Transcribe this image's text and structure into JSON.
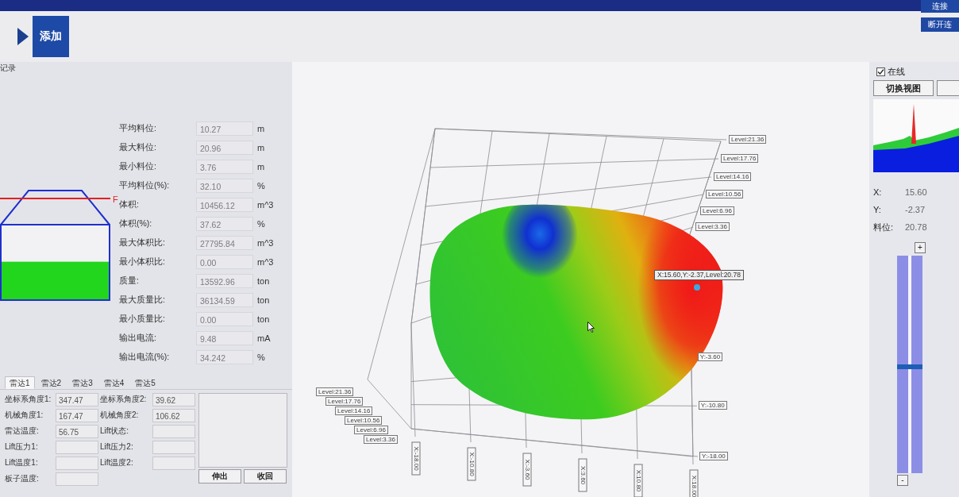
{
  "header": {
    "connect_button": "连接",
    "disconnect_button": "断开连",
    "add_tile": "添加"
  },
  "sidebar": {
    "record_label": "记录"
  },
  "silo": {
    "level": 0.32,
    "marker_label": "F"
  },
  "measurements": [
    {
      "label": "平均料位:",
      "value": "10.27",
      "unit": "m"
    },
    {
      "label": "最大料位:",
      "value": "20.96",
      "unit": "m"
    },
    {
      "label": "最小料位:",
      "value": "3.76",
      "unit": "m"
    },
    {
      "label": "平均料位(%):",
      "value": "32.10",
      "unit": "%"
    },
    {
      "label": "体积:",
      "value": "10456.12",
      "unit": "m^3"
    },
    {
      "label": "体积(%):",
      "value": "37.62",
      "unit": "%"
    },
    {
      "label": "最大体积比:",
      "value": "27795.84",
      "unit": "m^3"
    },
    {
      "label": "最小体积比:",
      "value": "0.00",
      "unit": "m^3"
    },
    {
      "label": "质量:",
      "value": "13592.96",
      "unit": "ton"
    },
    {
      "label": "最大质量比:",
      "value": "36134.59",
      "unit": "ton"
    },
    {
      "label": "最小质量比:",
      "value": "0.00",
      "unit": "ton"
    },
    {
      "label": "输出电流:",
      "value": "9.48",
      "unit": "mA"
    },
    {
      "label": "输出电流(%):",
      "value": "34.242",
      "unit": "%"
    }
  ],
  "radar": {
    "tabs": [
      {
        "label": "雷达1",
        "selected": true
      },
      {
        "label": "雷达2",
        "selected": false
      },
      {
        "label": "雷达3",
        "selected": false
      },
      {
        "label": "雷达4",
        "selected": false
      },
      {
        "label": "雷达5",
        "selected": false
      }
    ],
    "fields": [
      {
        "label": "坐标系角度1:",
        "value": "347.47"
      },
      {
        "label": "坐标系角度2:",
        "value": "39.62"
      },
      {
        "label": "机械角度1:",
        "value": "167.47"
      },
      {
        "label": "机械角度2:",
        "value": "106.62"
      },
      {
        "label": "雷达温度:",
        "value": "56.75"
      },
      {
        "label": "Lift状态:"
      },
      {
        "label": "Lift压力1:"
      },
      {
        "label": "Lift压力2:"
      },
      {
        "label": "Lift温度1:"
      },
      {
        "label": "Lift温度2:"
      },
      {
        "label": "板子温度:"
      }
    ],
    "buttons": [
      "伸出",
      "收回"
    ]
  },
  "chart": {
    "level_labels_right": [
      "Level:21.36",
      "Level:17.76",
      "Level:14.16",
      "Level:10.56",
      "Level:6.96",
      "Level:3.36"
    ],
    "level_labels_left": [
      "Level:21.36",
      "Level:17.76",
      "Level:14.16",
      "Level:10.56",
      "Level:6.96",
      "Level:3.36"
    ],
    "x_labels": [
      "X:-18.00",
      "X:-10.80",
      "X:-3.60",
      "X:3.60",
      "X:10.80",
      "X:18.00"
    ],
    "y_labels": [
      "Y:-3.60",
      "Y:-10.80",
      "Y:-18.00"
    ],
    "tooltip": "X:15.60,Y:-2.37,Level:20.78"
  },
  "right_panel": {
    "online": {
      "label": "在线",
      "checked": true
    },
    "switch_view_button": "切换视图",
    "readouts": [
      {
        "label": "X:",
        "value": "15.60"
      },
      {
        "label": "Y:",
        "value": "-2.37"
      },
      {
        "label": "料位:",
        "value": "20.78"
      }
    ],
    "slider": {
      "level": 0.49,
      "increase": "+",
      "decrease": "-"
    }
  }
}
